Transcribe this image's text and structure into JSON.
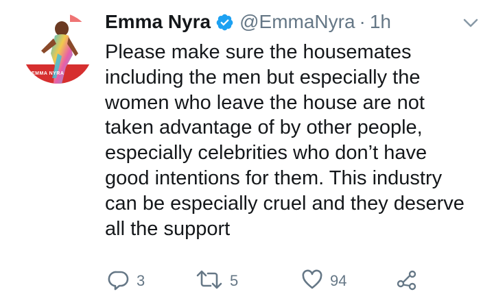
{
  "tweet": {
    "author": {
      "display_name": "Emma Nyra",
      "handle": "@EmmaNyra",
      "verified": true,
      "avatar_label": "EMMA NYRA"
    },
    "separator": "·",
    "time": "1h",
    "text_lines": [
      "Please make sure the housemates",
      "including the men but especially the",
      "women who leave the house are not",
      "taken advantage of by other people,",
      "especially celebrities who don’t have",
      "good intentions for them. This industry",
      "can be especially cruel and they deserve",
      "all the support"
    ],
    "actions": {
      "replies": "3",
      "retweets": "5",
      "likes": "94"
    },
    "icons": {
      "verified": "verified-badge-icon",
      "menu": "chevron-down-icon",
      "reply": "reply-icon",
      "retweet": "retweet-icon",
      "like": "heart-icon",
      "share": "share-icon"
    },
    "colors": {
      "text": "#14171a",
      "muted": "#657786",
      "verified": "#1da1f2",
      "avatar_band": "#d62f2f"
    }
  }
}
